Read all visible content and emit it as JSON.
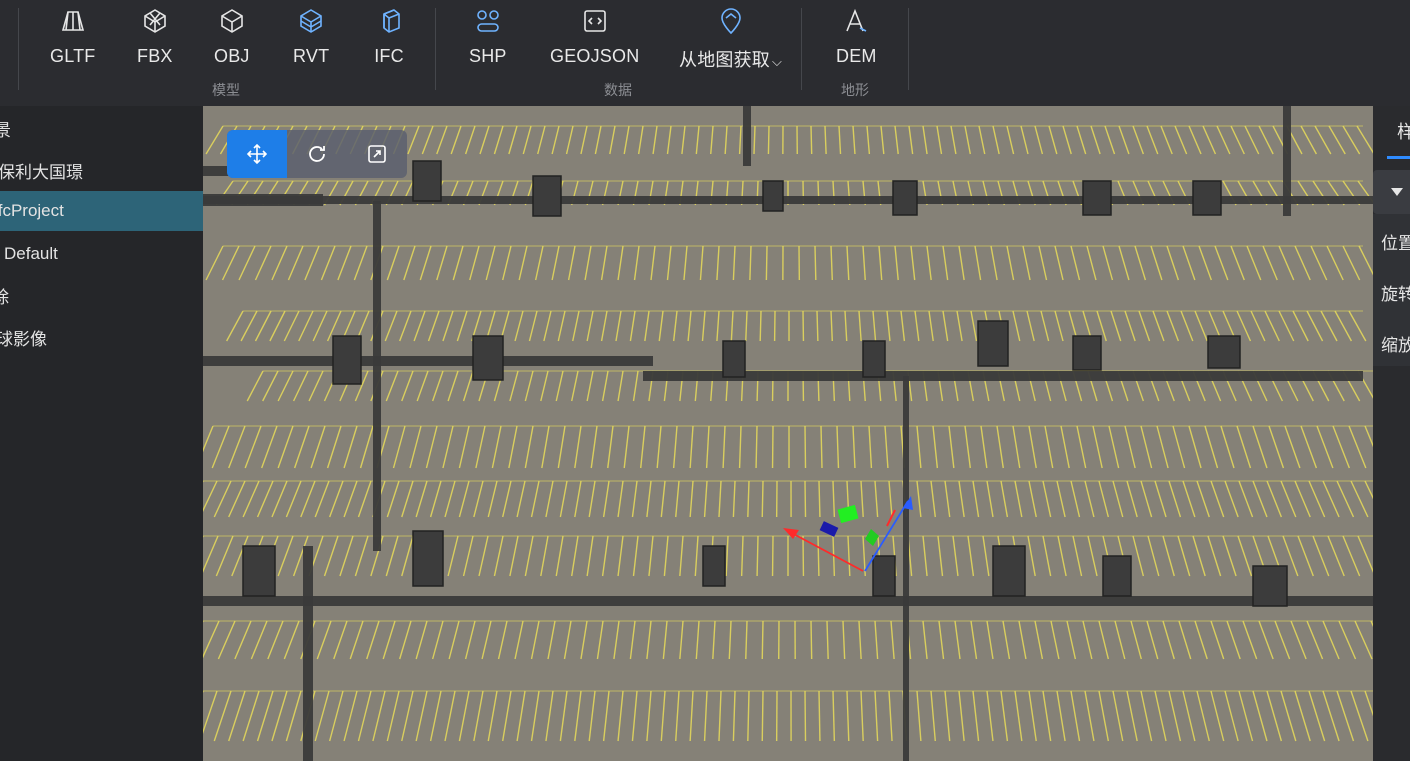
{
  "toolbar": {
    "buttons": [
      {
        "label": "GLTF",
        "icon": "gltf-icon"
      },
      {
        "label": "FBX",
        "icon": "fbx-icon"
      },
      {
        "label": "OBJ",
        "icon": "obj-icon"
      },
      {
        "label": "RVT",
        "icon": "rvt-icon"
      },
      {
        "label": "IFC",
        "icon": "ifc-icon"
      },
      {
        "label": "SHP",
        "icon": "shp-icon"
      },
      {
        "label": "GEOJSON",
        "icon": "geojson-icon"
      },
      {
        "label": "从地图获取",
        "icon": "map-pin-icon",
        "dropdown": "chevron-down-icon"
      },
      {
        "label": "DEM",
        "icon": "dem-icon"
      }
    ],
    "groups": {
      "model": "模型",
      "data": "数据",
      "terrain": "地形"
    }
  },
  "left_panel": {
    "items": [
      {
        "label": "景"
      },
      {
        "label": "保利大国璟"
      },
      {
        "label": "IfcProject"
      },
      {
        "label": "Default"
      },
      {
        "label": "除"
      },
      {
        "label": "球影像"
      }
    ]
  },
  "viewport": {
    "gizmo_tools": [
      {
        "name": "move-tool",
        "icon": "move-icon",
        "active": true
      },
      {
        "name": "rotate-tool",
        "icon": "rotate-icon",
        "active": false
      },
      {
        "name": "scale-tool",
        "icon": "scale-icon",
        "active": false
      }
    ],
    "colors": {
      "ground": "#858177",
      "parking_lines": "#e8dc5a",
      "walls": "#3a3a3a"
    }
  },
  "right_panel": {
    "tab": "样",
    "props": {
      "position": "位置",
      "rotation": "旋转",
      "scale": "缩放"
    }
  },
  "colors": {
    "accent": "#1e7ee8",
    "selected_row": "#2d6478"
  }
}
